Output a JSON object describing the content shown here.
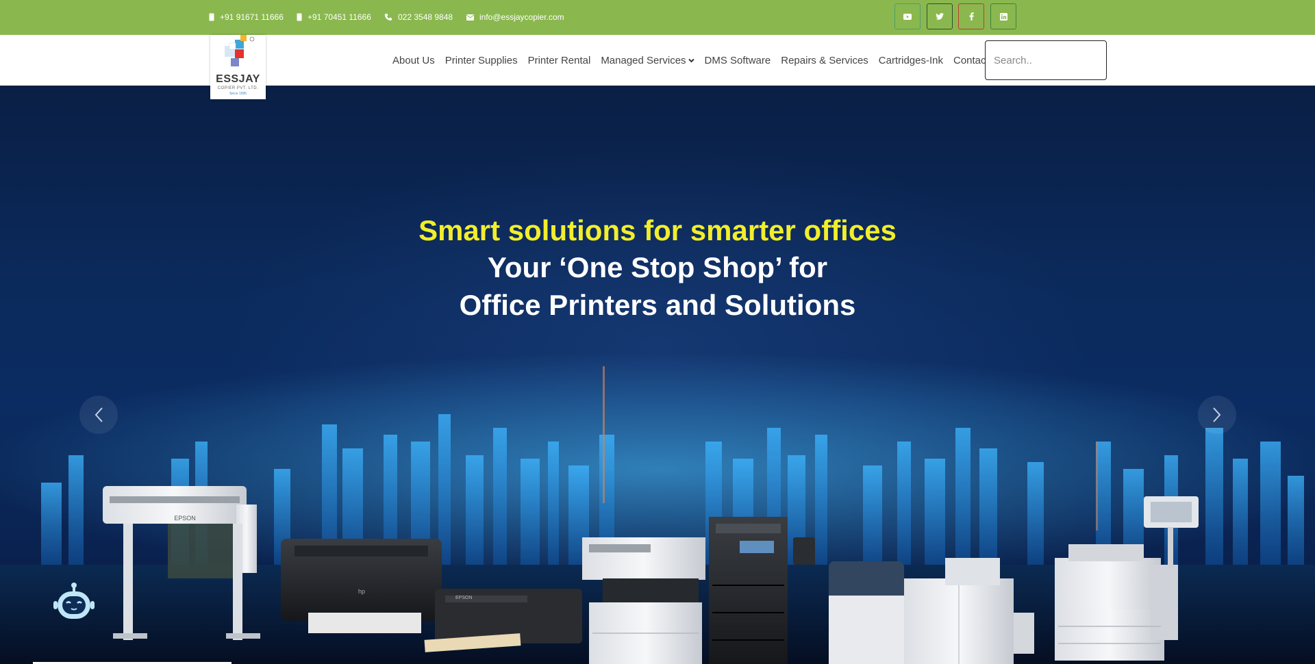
{
  "topbar": {
    "phone1": "+91 91671 11666",
    "phone2": "+91 70451 11666",
    "landline": "022 3548 9848",
    "email": "info@essjaycopier.com",
    "social": [
      {
        "icon": "youtube-icon",
        "border": "#4a9e6b"
      },
      {
        "icon": "twitter-icon",
        "border": "#2f4f2f"
      },
      {
        "icon": "facebook-icon",
        "border": "#c0392b"
      },
      {
        "icon": "linkedin-icon",
        "border": "#3e7f3e"
      }
    ]
  },
  "logo": {
    "name": "ESSJAY",
    "sub": "COPIER PVT. LTD.",
    "since": "Since 1995"
  },
  "nav": {
    "items": [
      "About Us",
      "Printer Supplies",
      "Printer Rental",
      "Managed Services",
      "DMS Software",
      "Repairs & Services",
      "Cartridges-Ink",
      "Contact"
    ],
    "search_placeholder": "Search.."
  },
  "hero": {
    "line1": "Smart solutions for smarter offices",
    "line2": "Your ‘One Stop Shop’ for",
    "line3": "Office Printers and Solutions",
    "printer_brands": [
      "EPSON",
      "hp",
      "EPSON"
    ]
  },
  "colors": {
    "topbar": "#8ab84f",
    "headline_accent": "#f2ee2a",
    "hero_bg": "#0b2a5c"
  }
}
